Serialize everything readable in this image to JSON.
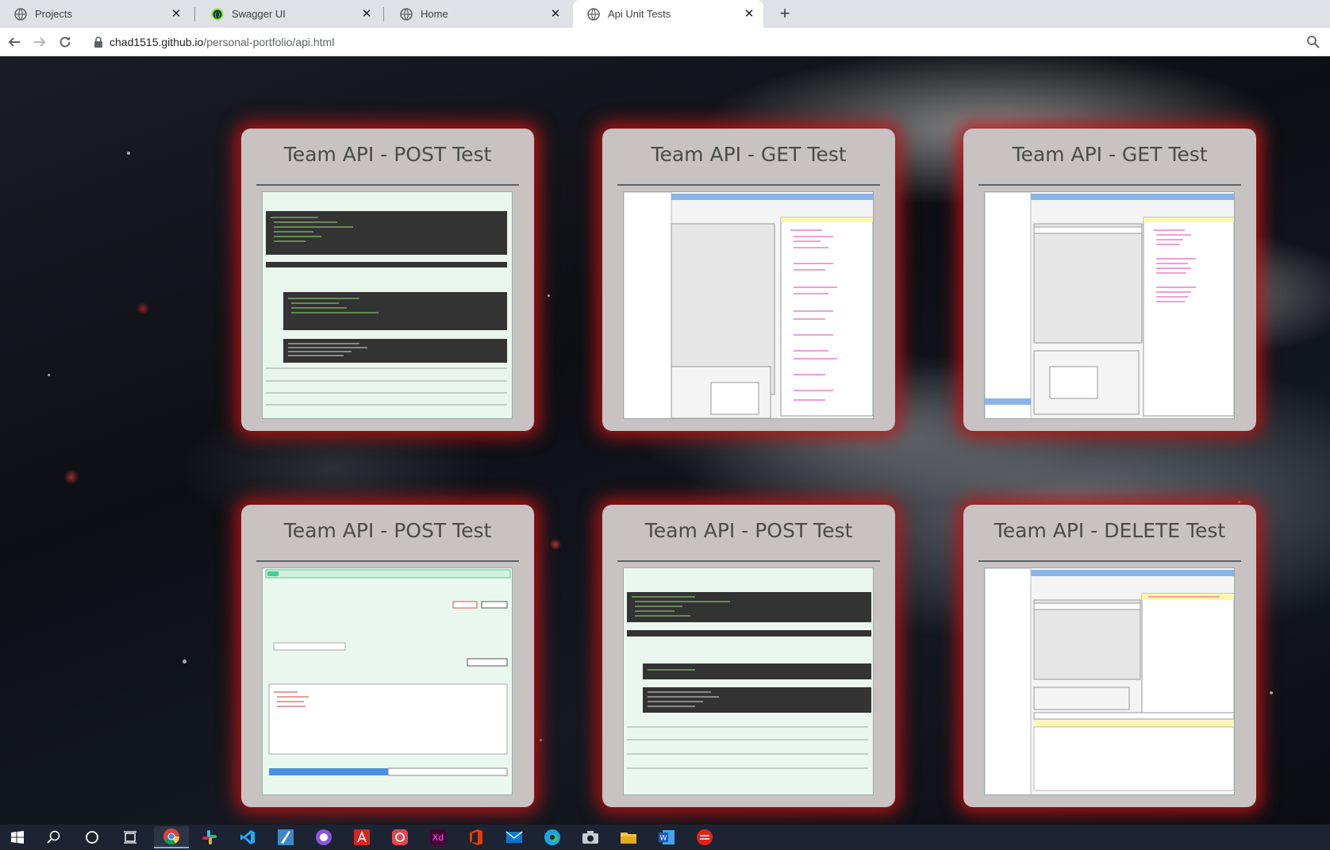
{
  "browser": {
    "tabs": [
      {
        "title": "Projects",
        "icon": "globe-icon"
      },
      {
        "title": "Swagger UI",
        "icon": "swagger-icon"
      },
      {
        "title": "Home",
        "icon": "globe-icon"
      },
      {
        "title": "Api Unit Tests",
        "icon": "globe-icon",
        "active": true
      }
    ],
    "new_tab_label": "+",
    "url_host": "chad1515.github.io",
    "url_path": "/personal-portfolio/api.html"
  },
  "cards": [
    {
      "title": "Team API - POST Test",
      "screenshot": "swagger-post-response"
    },
    {
      "title": "Team API - GET Test",
      "screenshot": "soapui-get-response"
    },
    {
      "title": "Team API - GET Test",
      "screenshot": "soapui-get-by-id"
    },
    {
      "title": "Team API - POST Test",
      "screenshot": "swagger-post-request"
    },
    {
      "title": "Team API - POST Test",
      "screenshot": "swagger-post-curl"
    },
    {
      "title": "Team API - DELETE Test",
      "screenshot": "soapui-delete"
    }
  ],
  "taskbar": {
    "items": [
      "windows-start-icon",
      "search-icon",
      "cortana-icon",
      "task-view-icon",
      "chrome-icon",
      "slack-icon",
      "vscode-icon",
      "krita-icon",
      "github-desktop-icon",
      "acrobat-icon",
      "creative-cloud-icon",
      "adobe-xd-icon",
      "office-icon",
      "mail-icon",
      "edge-icon",
      "camera-icon",
      "file-explorer-icon",
      "word-icon",
      "tiger-app-icon"
    ]
  },
  "colors": {
    "card_bg": "#c8c2c2",
    "card_glow": "#be1414",
    "card_title": "#4b4b4b",
    "taskbar": "#1c2433"
  }
}
